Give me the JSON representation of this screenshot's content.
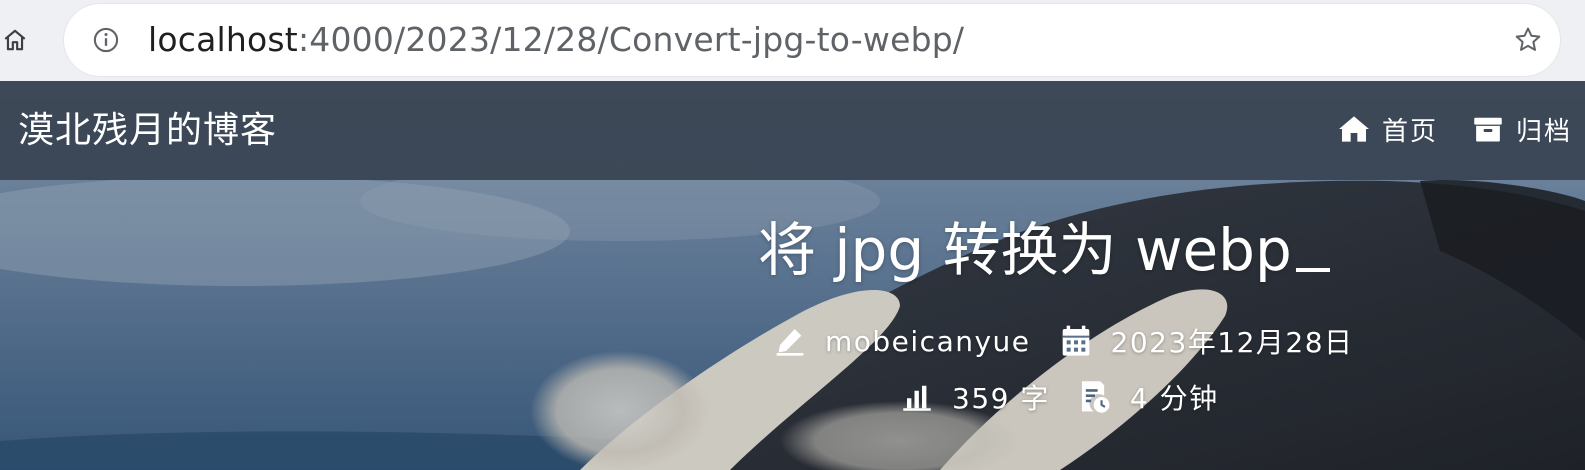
{
  "browser": {
    "url_host": "localhost",
    "url_path": ":4000/2023/12/28/Convert-jpg-to-webp/",
    "home_icon": "home-icon",
    "info_icon": "info-icon",
    "bookmark_icon": "star-icon"
  },
  "site": {
    "brand": "漠北残月的博客",
    "nav": [
      {
        "label": "首页",
        "icon": "home-icon"
      },
      {
        "label": "归档",
        "icon": "archive-icon"
      }
    ]
  },
  "post": {
    "title": "将 jpg 转换为 webp",
    "author": "mobeicanyue",
    "date": "2023年12月28日",
    "word_count": "359 字",
    "read_time": "4 分钟"
  },
  "colors": {
    "navbar": "#3a4654",
    "chrome_bg": "#eef0f4",
    "url_path": "#5f6368",
    "text_on_hero": "#ffffff",
    "sky": "#5a7a9c"
  }
}
